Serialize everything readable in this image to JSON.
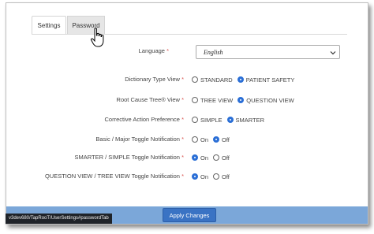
{
  "tabs": {
    "settings": "Settings",
    "password": "Password"
  },
  "language": {
    "label": "Language",
    "value": "English"
  },
  "rows": [
    {
      "label": "Dictionary Type View",
      "options": [
        "STANDARD",
        "PATIENT SAFETY"
      ],
      "selected": "PATIENT SAFETY"
    },
    {
      "label": "Root Cause Tree® View",
      "options": [
        "TREE VIEW",
        "QUESTION VIEW"
      ],
      "selected": "QUESTION VIEW"
    },
    {
      "label": "Corrective Action Preference",
      "options": [
        "SIMPLE",
        "SMARTER"
      ],
      "selected": "SMARTER"
    },
    {
      "label": "Basic / Major Toggle Notification",
      "options": [
        "On",
        "Off"
      ],
      "selected": "Off"
    },
    {
      "label": "SMARTER / SIMPLE Toggle Notification",
      "options": [
        "On",
        "Off"
      ],
      "selected": "On"
    },
    {
      "label": "QUESTION VIEW / TREE VIEW Toggle Notification",
      "options": [
        "On",
        "Off"
      ],
      "selected": "On"
    }
  ],
  "required_marker": "*",
  "apply_button": "Apply Changes",
  "status_url": "v3dev680/TapRooT/UserSettings#passwordTab",
  "colors": {
    "accent": "#3a73c4",
    "bar": "#7ba7d9",
    "required": "#d9534f"
  }
}
